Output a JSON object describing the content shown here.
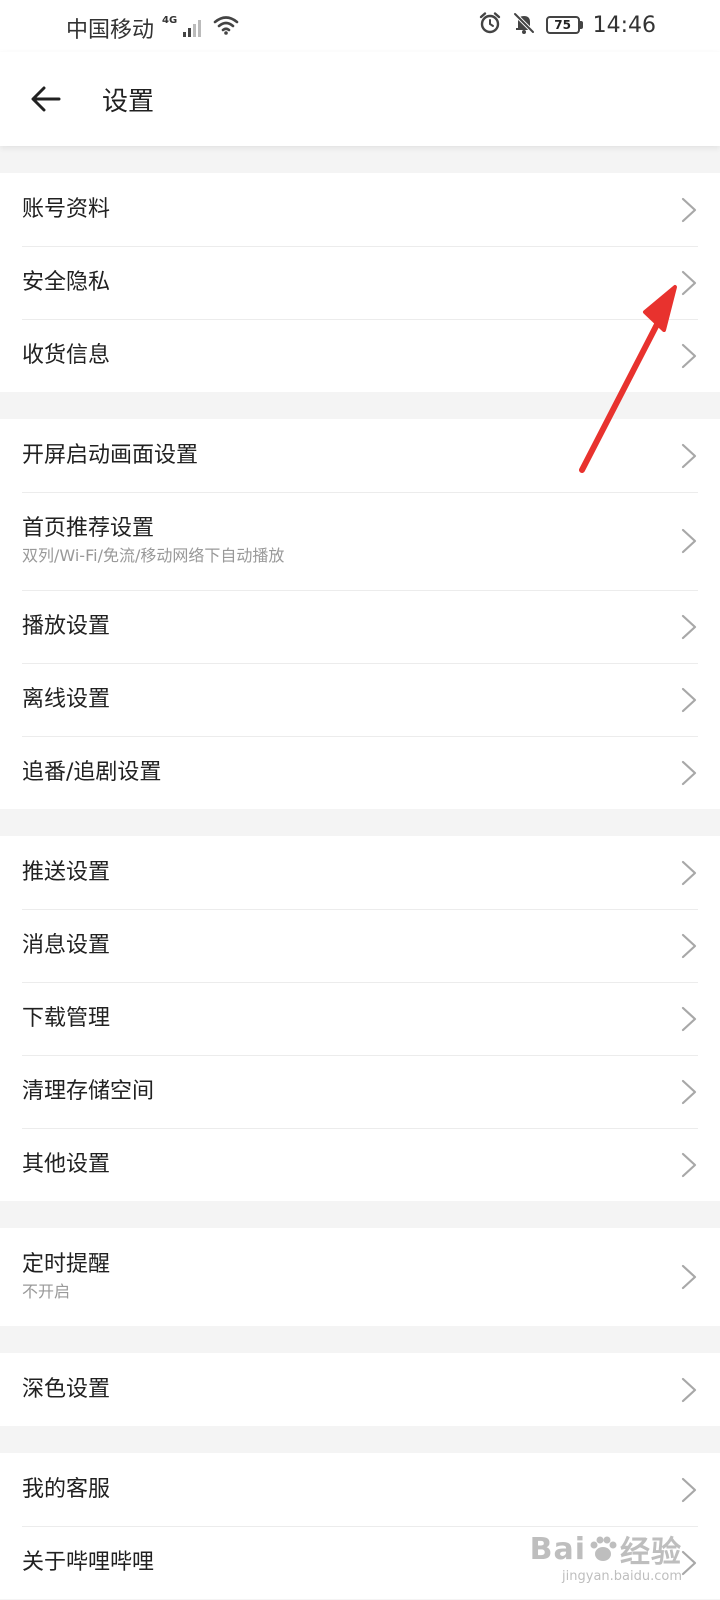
{
  "status_bar": {
    "carrier": "中国移动",
    "network": "4G",
    "battery": "75",
    "time": "14:46"
  },
  "header": {
    "title": "设置"
  },
  "groups": [
    {
      "items": [
        {
          "label": "账号资料",
          "sub": ""
        },
        {
          "label": "安全隐私",
          "sub": ""
        },
        {
          "label": "收货信息",
          "sub": ""
        }
      ]
    },
    {
      "items": [
        {
          "label": "开屏启动画面设置",
          "sub": ""
        },
        {
          "label": "首页推荐设置",
          "sub": "双列/Wi-Fi/免流/移动网络下自动播放"
        },
        {
          "label": "播放设置",
          "sub": ""
        },
        {
          "label": "离线设置",
          "sub": ""
        },
        {
          "label": "追番/追剧设置",
          "sub": ""
        }
      ]
    },
    {
      "items": [
        {
          "label": "推送设置",
          "sub": ""
        },
        {
          "label": "消息设置",
          "sub": ""
        },
        {
          "label": "下载管理",
          "sub": ""
        },
        {
          "label": "清理存储空间",
          "sub": ""
        },
        {
          "label": "其他设置",
          "sub": ""
        }
      ]
    },
    {
      "items": [
        {
          "label": "定时提醒",
          "sub": "不开启"
        }
      ]
    },
    {
      "items": [
        {
          "label": "深色设置",
          "sub": ""
        }
      ]
    },
    {
      "items": [
        {
          "label": "我的客服",
          "sub": ""
        },
        {
          "label": "关于哔哩哔哩",
          "sub": ""
        }
      ]
    }
  ],
  "watermark": {
    "brand_left": "Bai",
    "brand_right": "经验",
    "url": "jingyan.baidu.com"
  },
  "colors": {
    "annotation_arrow": "#e8322e",
    "background": "#f4f4f4",
    "divider": "#ececec",
    "chevron": "#a8a8a8"
  },
  "icons": {
    "back": "arrow-left-icon",
    "chevron": "chevron-right-icon",
    "alarm": "alarm-clock-icon",
    "mute": "bell-off-icon",
    "wifi": "wifi-icon",
    "signal": "signal-icon"
  }
}
